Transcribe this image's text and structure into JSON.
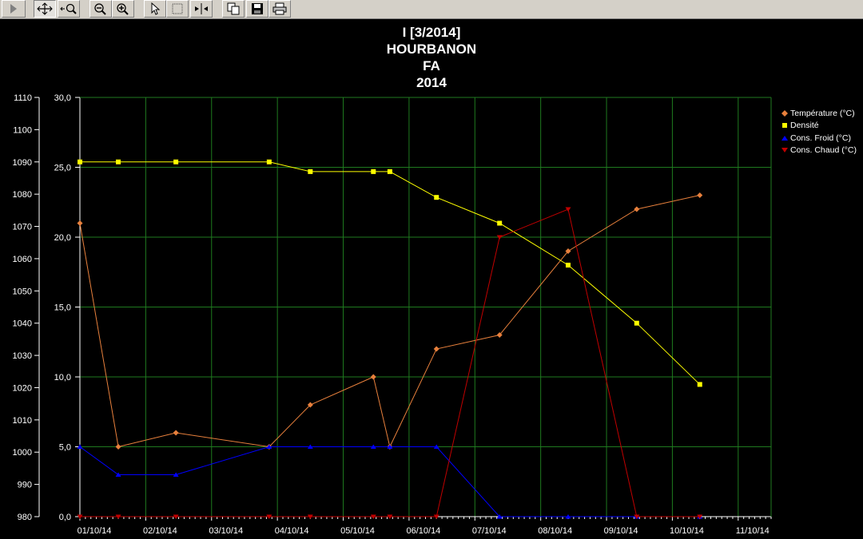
{
  "toolbar": {
    "buttons": [
      {
        "name": "play-button",
        "icon": "play-icon"
      },
      {
        "name": "pan-button",
        "icon": "pan-arrows-icon"
      },
      {
        "name": "zoom-area-button",
        "icon": "zoom-area-icon"
      },
      {
        "name": "zoom-out-button",
        "icon": "zoom-out-icon"
      },
      {
        "name": "zoom-in-button",
        "icon": "zoom-in-icon"
      },
      {
        "name": "select-button",
        "icon": "cursor-arrow-icon"
      },
      {
        "name": "rectangle-button",
        "icon": "rectangle-icon"
      },
      {
        "name": "split-button",
        "icon": "split-arrows-icon"
      },
      {
        "name": "copy-button",
        "icon": "copy-icon"
      },
      {
        "name": "save-button",
        "icon": "floppy-disk-icon"
      },
      {
        "name": "print-button",
        "icon": "printer-icon"
      }
    ]
  },
  "colors": {
    "background": "#000000",
    "grid": "#1f7a1f",
    "temperature": "#e8803c",
    "densite": "#ffff00",
    "froid": "#0000ff",
    "chaud": "#c00000"
  },
  "chart_data": {
    "type": "line",
    "title_lines": [
      "I [3/2014]",
      "HOURBANON",
      "FA",
      "2014"
    ],
    "grid": true,
    "legend_position": "right",
    "x_ticks": [
      "01/10/14",
      "02/10/14",
      "03/10/14",
      "04/10/14",
      "05/10/14",
      "06/10/14",
      "07/10/14",
      "08/10/14",
      "09/10/14",
      "10/10/14",
      "11/10/14"
    ],
    "x_range": [
      "2014-10-01",
      "2014-10-11T12:00"
    ],
    "y_right_axis": {
      "range": [
        0,
        30
      ],
      "ticks": [
        "0,0",
        "5,0",
        "10,0",
        "15,0",
        "20,0",
        "25,0",
        "30,0"
      ]
    },
    "y_left_axis": {
      "range": [
        980,
        1110
      ],
      "ticks": [
        "980",
        "990",
        "1000",
        "1010",
        "1020",
        "1030",
        "1040",
        "1050",
        "1060",
        "1070",
        "1080",
        "1090",
        "1100",
        "1110"
      ]
    },
    "series": [
      {
        "name": "Température (°C)",
        "axis": "right",
        "marker": "diamond",
        "x": [
          "2014-10-01T00:00",
          "2014-10-01T14:00",
          "2014-10-02T11:00",
          "2014-10-03T21:00",
          "2014-10-04T12:00",
          "2014-10-05T11:00",
          "2014-10-05T17:00",
          "2014-10-06T10:00",
          "2014-10-07T09:00",
          "2014-10-08T10:00",
          "2014-10-09T11:00",
          "2014-10-10T10:00"
        ],
        "y": [
          21.0,
          5.0,
          6.0,
          5.0,
          8.0,
          10.0,
          5.0,
          12.0,
          13.0,
          19.0,
          22.0,
          23.0
        ]
      },
      {
        "name": "Densité",
        "axis": "left",
        "marker": "square",
        "x": [
          "2014-10-01T00:00",
          "2014-10-01T14:00",
          "2014-10-02T11:00",
          "2014-10-03T21:00",
          "2014-10-04T12:00",
          "2014-10-05T11:00",
          "2014-10-05T17:00",
          "2014-10-06T10:00",
          "2014-10-07T09:00",
          "2014-10-08T10:00",
          "2014-10-09T11:00",
          "2014-10-10T10:00"
        ],
        "y": [
          1090,
          1090,
          1090,
          1090,
          1087,
          1087,
          1087,
          1079,
          1071,
          1058,
          1040,
          1021
        ]
      },
      {
        "name": "Cons. Froid (°C)",
        "axis": "right",
        "marker": "triangle-up",
        "x": [
          "2014-10-01T00:00",
          "2014-10-01T14:00",
          "2014-10-02T11:00",
          "2014-10-03T21:00",
          "2014-10-04T12:00",
          "2014-10-05T11:00",
          "2014-10-05T17:00",
          "2014-10-06T10:00",
          "2014-10-07T09:00",
          "2014-10-08T10:00",
          "2014-10-09T11:00",
          "2014-10-10T10:00"
        ],
        "y": [
          5.0,
          3.0,
          3.0,
          5.0,
          5.0,
          5.0,
          5.0,
          5.0,
          0.0,
          0.0,
          0.0,
          0.0
        ]
      },
      {
        "name": "Cons. Chaud (°C)",
        "axis": "right",
        "marker": "triangle-down",
        "x": [
          "2014-10-01T00:00",
          "2014-10-01T14:00",
          "2014-10-02T11:00",
          "2014-10-03T21:00",
          "2014-10-04T12:00",
          "2014-10-05T11:00",
          "2014-10-05T17:00",
          "2014-10-06T10:00",
          "2014-10-07T09:00",
          "2014-10-08T10:00",
          "2014-10-09T11:00",
          "2014-10-10T10:00"
        ],
        "y": [
          0.0,
          0.0,
          0.0,
          0.0,
          0.0,
          0.0,
          0.0,
          0.0,
          20.0,
          22.0,
          0.0,
          0.0
        ]
      }
    ]
  }
}
